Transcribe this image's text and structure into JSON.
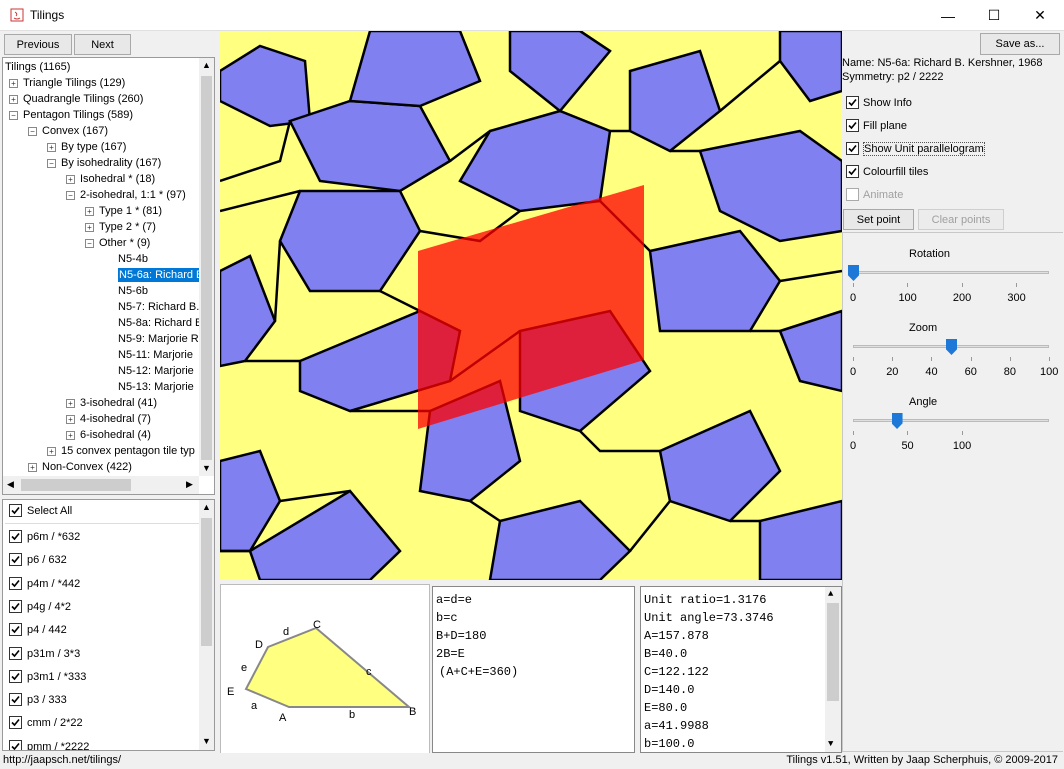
{
  "window": {
    "title": "Tilings",
    "controls": {
      "minimize": "—",
      "maximize": "☐",
      "close": "✕"
    }
  },
  "nav": {
    "previous": "Previous",
    "next": "Next"
  },
  "tree": [
    {
      "label": "Tilings (1165)",
      "depth": 0,
      "exp": "none"
    },
    {
      "label": "Triangle Tilings (129)",
      "depth": 1,
      "exp": "plus"
    },
    {
      "label": "Quadrangle Tilings (260)",
      "depth": 1,
      "exp": "plus"
    },
    {
      "label": "Pentagon Tilings (589)",
      "depth": 1,
      "exp": "minus"
    },
    {
      "label": "Convex (167)",
      "depth": 2,
      "exp": "minus"
    },
    {
      "label": "By type (167)",
      "depth": 3,
      "exp": "plus"
    },
    {
      "label": "By isohedrality (167)",
      "depth": 3,
      "exp": "minus"
    },
    {
      "label": "Isohedral * (18)",
      "depth": 4,
      "exp": "plus"
    },
    {
      "label": "2-isohedral, 1:1 * (97)",
      "depth": 4,
      "exp": "minus"
    },
    {
      "label": "Type 1 * (81)",
      "depth": 5,
      "exp": "plus"
    },
    {
      "label": "Type 2 * (7)",
      "depth": 5,
      "exp": "plus"
    },
    {
      "label": "Other * (9)",
      "depth": 5,
      "exp": "minus"
    },
    {
      "label": "N5-4b",
      "depth": 6,
      "exp": "leaf"
    },
    {
      "label": "N5-6a: Richard B",
      "depth": 6,
      "exp": "leaf",
      "selected": true
    },
    {
      "label": "N5-6b",
      "depth": 6,
      "exp": "leaf"
    },
    {
      "label": "N5-7: Richard B.",
      "depth": 6,
      "exp": "leaf"
    },
    {
      "label": "N5-8a: Richard B",
      "depth": 6,
      "exp": "leaf"
    },
    {
      "label": "N5-9: Marjorie R",
      "depth": 6,
      "exp": "leaf"
    },
    {
      "label": "N5-11: Marjorie",
      "depth": 6,
      "exp": "leaf"
    },
    {
      "label": "N5-12: Marjorie",
      "depth": 6,
      "exp": "leaf"
    },
    {
      "label": "N5-13: Marjorie",
      "depth": 6,
      "exp": "leaf"
    },
    {
      "label": "3-isohedral (41)",
      "depth": 4,
      "exp": "plus"
    },
    {
      "label": "4-isohedral (7)",
      "depth": 4,
      "exp": "plus"
    },
    {
      "label": "6-isohedral (4)",
      "depth": 4,
      "exp": "plus"
    },
    {
      "label": "15 convex pentagon tile typ",
      "depth": 3,
      "exp": "plus"
    },
    {
      "label": "Non-Convex (422)",
      "depth": 2,
      "exp": "plus"
    }
  ],
  "symmetry_filters": {
    "select_all": "Select All",
    "items": [
      "p6m / *632",
      "p6 / 632",
      "p4m / *442",
      "p4g / 4*2",
      "p4 / 442",
      "p31m / 3*3",
      "p3m1 / *333",
      "p3 / 333",
      "cmm / 2*22",
      "pmm / *2222"
    ]
  },
  "info": {
    "name": "Name: N5-6a: Richard B. Kershner, 1968",
    "symmetry": "Symmetry: p2 / 2222"
  },
  "buttons": {
    "save_as": "Save as...",
    "set_point": "Set point",
    "clear_points": "Clear points"
  },
  "options": [
    {
      "label": "Show Info",
      "checked": true,
      "enabled": true
    },
    {
      "label": "Fill plane",
      "checked": true,
      "enabled": true
    },
    {
      "label": "Show Unit parallelogram",
      "checked": true,
      "enabled": true
    },
    {
      "label": "Colourfill tiles",
      "checked": true,
      "enabled": true
    },
    {
      "label": "Animate",
      "checked": false,
      "enabled": false
    }
  ],
  "sliders": {
    "rotation": {
      "label": "Rotation",
      "value": 0,
      "ticks": [
        "0",
        "100",
        "200",
        "300"
      ]
    },
    "zoom": {
      "label": "Zoom",
      "value": 50,
      "ticks": [
        "0",
        "20",
        "40",
        "60",
        "80",
        "100"
      ]
    },
    "angle": {
      "label": "Angle",
      "value": 40,
      "ticks": [
        "0",
        "50",
        "100"
      ]
    }
  },
  "tile_labels": {
    "A": "A",
    "B": "B",
    "C": "C",
    "D": "D",
    "E": "E",
    "a": "a",
    "b": "b",
    "c": "c",
    "d": "d",
    "e": "e"
  },
  "conditions": [
    "a=d=e",
    "b=c",
    "B+D=180",
    "2B=E",
    "(A+C+E=360)"
  ],
  "measurements": [
    "Unit ratio=1.3176",
    "Unit angle=73.3746",
    "A=157.878",
    "B=40.0",
    "C=122.122",
    "D=140.0",
    "E=80.0",
    "a=41.9988",
    "b=100.0"
  ],
  "status": {
    "url": "http://jaapsch.net/tilings/",
    "credit": "Tilings v1.51, Written by Jaap Scherphuis, © 2009-2017"
  },
  "colors": {
    "yellow": "#ffff80",
    "blue": "#8080f0",
    "parallelogram": "#ff0000",
    "selection": "#0078d7"
  }
}
